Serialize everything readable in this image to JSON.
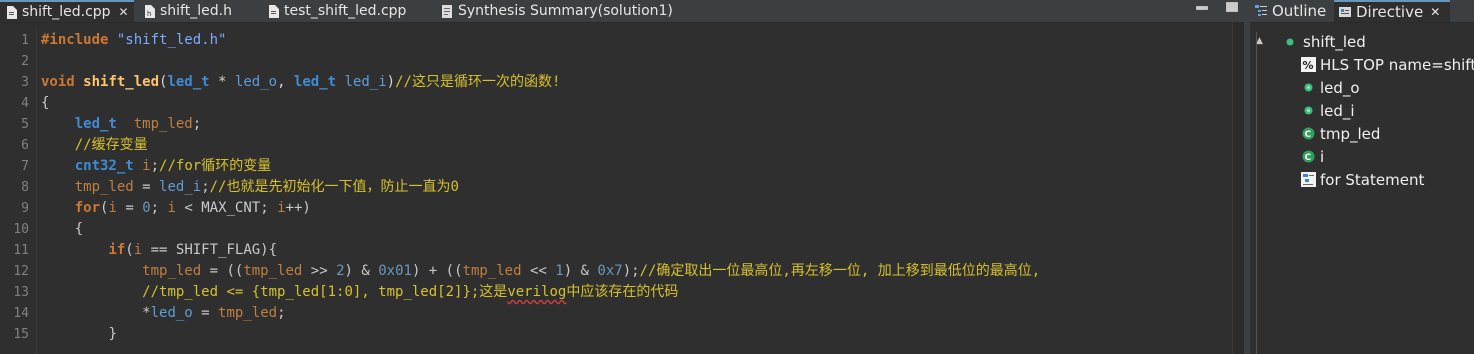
{
  "editor": {
    "tabs": [
      {
        "label": "shift_led.cpp",
        "active": true,
        "icon": "cpp-file-icon",
        "closable": true
      },
      {
        "label": "shift_led.h",
        "active": false,
        "icon": "header-file-icon"
      },
      {
        "label": "test_shift_led.cpp",
        "active": false,
        "icon": "cpp-file-icon"
      },
      {
        "label": "Synthesis Summary(solution1)",
        "active": false,
        "icon": "report-icon"
      }
    ],
    "close_glyph": "✕",
    "line_numbers": [
      "1",
      "2",
      "3",
      "4",
      "5",
      "6",
      "7",
      "8",
      "9",
      "10",
      "11",
      "12",
      "13",
      "14",
      "15"
    ],
    "code": {
      "l1_pp": "#include",
      "l1_str": " \"shift_led.h\"",
      "l3_void": "void",
      "l3_fn": "shift_led",
      "l3_t1": "led_t",
      "l3_a": " * ",
      "l3_p1": "led_o",
      "l3_b": ", ",
      "l3_t2": "led_t",
      "l3_c": " ",
      "l3_p2": "led_i",
      "l3_d": ")",
      "l3_cmt": "//这只是循环一次的函数!",
      "l3_open": "(",
      "l4": "{",
      "l5_ty": "led_t",
      "l5_var": "tmp_led",
      "l5_end": ";",
      "l6_cmt": "//缓存变量",
      "l7_ty": "cnt32_t",
      "l7_var": "i",
      "l7_end": ";",
      "l7_cmt": "//for循环的变量",
      "l8_var": "tmp_led",
      "l8_eq": " = ",
      "l8_p": "led_i",
      "l8_end": ";",
      "l8_cmt": "//也就是先初始化一下值，防止一直为0",
      "l9_kw": "for",
      "l9_a": "(",
      "l9_v1": "i",
      "l9_b": " = ",
      "l9_n": "0",
      "l9_c": "; ",
      "l9_v2": "i",
      "l9_d": " < MAX_CNT; ",
      "l9_v3": "i",
      "l9_e": "++)",
      "l10": "{",
      "l11_kw": "if",
      "l11_a": "(",
      "l11_v": "i",
      "l11_b": " == SHIFT_FLAG){",
      "l12_v1": "tmp_led",
      "l12_a": " = ((",
      "l12_v2": "tmp_led",
      "l12_b": " >> ",
      "l12_n1": "2",
      "l12_c": ") & ",
      "l12_n2": "0x01",
      "l12_d": ") + ((",
      "l12_v3": "tmp_led",
      "l12_e": " << ",
      "l12_n3": "1",
      "l12_f": ") & ",
      "l12_n4": "0x7",
      "l12_g": ");",
      "l12_cmt": "//确定取出一位最高位,再左移一位, 加上移到最低位的最高位,",
      "l13_cmt_a": "//tmp_led <= {tmp_led[1:0], tmp_led[2]};这是",
      "l13_cmt_sq": "verilog",
      "l13_cmt_b": "中应该存在的代码",
      "l14_a": "*",
      "l14_p": "led_o",
      "l14_b": " = ",
      "l14_v": "tmp_led",
      "l14_c": ";",
      "l15": "}"
    }
  },
  "outline": {
    "tabs": [
      {
        "label": "Outline",
        "icon": "outline-icon",
        "active": false
      },
      {
        "label": "Directive",
        "icon": "directive-icon",
        "active": true,
        "close_glyph": "✕"
      }
    ],
    "tree": [
      {
        "label": "shift_led",
        "icon": "function-icon",
        "level": 0
      },
      {
        "label": "HLS TOP name=shift_",
        "icon": "pragma-icon",
        "level": 1
      },
      {
        "label": "led_o",
        "icon": "port-icon",
        "level": 1
      },
      {
        "label": "led_i",
        "icon": "port-icon",
        "level": 1
      },
      {
        "label": "tmp_led",
        "icon": "variable-icon",
        "level": 1
      },
      {
        "label": "i",
        "icon": "variable-icon",
        "level": 1
      },
      {
        "label": "for Statement",
        "icon": "loop-icon",
        "level": 1
      }
    ],
    "twisty": "▲"
  },
  "colors": {
    "background": "#2f2f2f",
    "keyword": "#cc7832",
    "function": "#ffc66d",
    "type": "#3f8bd4",
    "comment": "#d6c22b",
    "number": "#6897bb"
  }
}
